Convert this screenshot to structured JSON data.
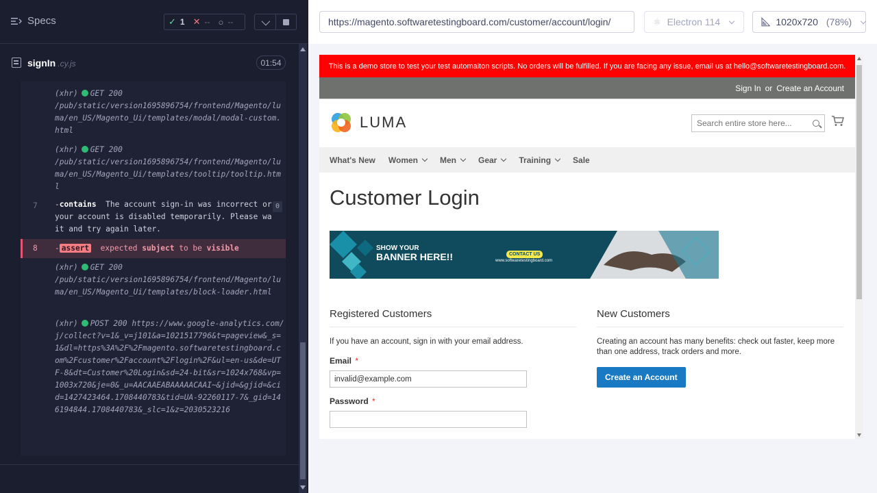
{
  "runner": {
    "specs_label": "Specs",
    "stats": {
      "passed": "1",
      "failed": "--",
      "pending": "--"
    },
    "spec": {
      "name": "signIn",
      "ext": ".cy.js",
      "duration": "01:54"
    },
    "log": [
      {
        "type": "xhr",
        "label": "(xhr)",
        "method": "GET 200",
        "text": "/pub/static/version1695896754/frontend/Magento/luma/en_US/Magento_Ui/templates/modal/modal-custom.html"
      },
      {
        "type": "xhr",
        "label": "(xhr)",
        "method": "GET 200",
        "text": "/pub/static/version1695896754/frontend/Magento/luma/en_US/Magento_Ui/templates/tooltip/tooltip.html"
      },
      {
        "type": "cmd",
        "num": "7",
        "command": "contains",
        "text": "The account sign-in was incorrect or your account is disabled temporarily. Please wait and try again later.",
        "badge": "0"
      },
      {
        "type": "assert",
        "num": "8",
        "command": "assert",
        "parts": [
          "expected",
          "subject",
          "to be",
          "visible"
        ]
      },
      {
        "type": "xhr",
        "label": "(xhr)",
        "method": "GET 200",
        "text": "/pub/static/version1695896754/frontend/Magento/luma/en_US/Magento_Ui/templates/block-loader.html"
      },
      {
        "type": "xhr",
        "label": "(xhr)",
        "method": "POST 200",
        "text": "https://www.google-analytics.com/j/collect?v=1&_v=j101&a=1021517796&t=pageview&_s=1&dl=https%3A%2F%2Fmagento.softwaretestingboard.com%2Fcustomer%2Faccount%2Flogin%2F&ul=en-us&de=UTF-8&dt=Customer%20Login&sd=24-bit&sr=1024x768&vp=1003x720&je=0&_u=AACAAEABAAAAACAAI~&jid=&gjid=&cid=1427423464.1708440783&tid=UA-92260117-7&_gid=146194844.1708440783&_slc=1&z=2030523216"
      }
    ]
  },
  "aut_bar": {
    "url": "https://magento.softwaretestingboard.com/customer/account/login/",
    "browser": "Electron 114",
    "viewport": "1020x720",
    "zoom": "(78%)"
  },
  "site": {
    "demo_notice": "This is a demo store to test your test automaiton scripts. No orders will be fulfilled. If you are facing any issue, email us at hello@softwaretestingboard.com.",
    "header_links": {
      "sign_in": "Sign In",
      "or": "or",
      "create": "Create an Account"
    },
    "logo_text": "LUMA",
    "search_placeholder": "Search entire store here...",
    "nav": [
      {
        "label": "What's New",
        "has_menu": false
      },
      {
        "label": "Women",
        "has_menu": true
      },
      {
        "label": "Men",
        "has_menu": true
      },
      {
        "label": "Gear",
        "has_menu": true
      },
      {
        "label": "Training",
        "has_menu": true
      },
      {
        "label": "Sale",
        "has_menu": false
      }
    ],
    "page_title": "Customer Login",
    "promo": {
      "line1": "SHOW YOUR",
      "line2": "BANNER HERE!!",
      "contact": "CONTACT US",
      "site": "www.softwaretestingboard.com"
    },
    "registered": {
      "title": "Registered Customers",
      "desc": "If you have an account, sign in with your email address.",
      "email_label": "Email",
      "email_value": "invalid@example.com",
      "password_label": "Password",
      "required": "*"
    },
    "new_customers": {
      "title": "New Customers",
      "desc": "Creating an account has many benefits: check out faster, keep more than one address, track orders and more.",
      "button": "Create an Account"
    }
  },
  "colors": {
    "runner_bg": "#1b1e2e",
    "demo_banner": "#ff0101",
    "primary_button": "#1979c3",
    "fail_accent": "#e45770",
    "pass": "#69d3a7"
  }
}
